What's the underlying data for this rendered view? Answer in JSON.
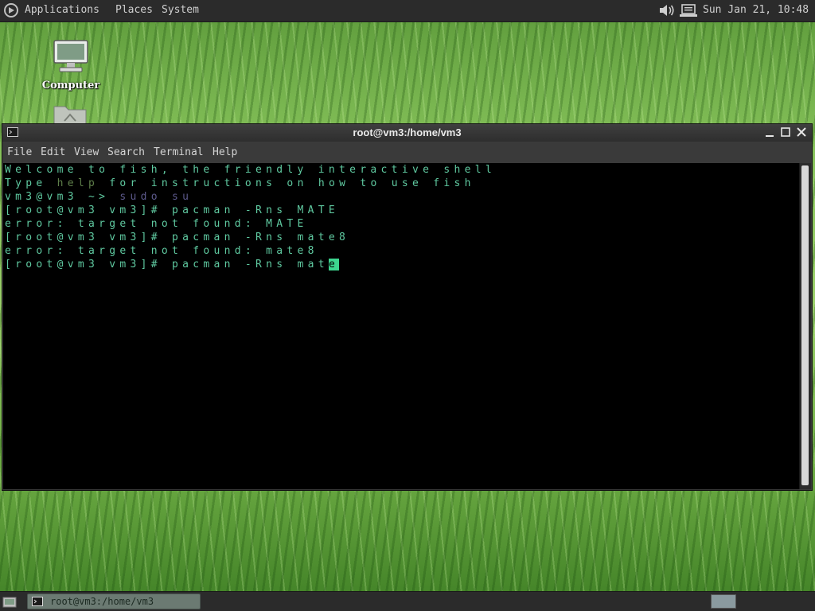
{
  "top_panel": {
    "menus": [
      "Applications",
      "Places",
      "System"
    ],
    "clock": "Sun Jan 21, 10:48",
    "icons": [
      "mate-menu-logo-icon",
      "speaker-volume-icon",
      "network-icon"
    ]
  },
  "desktop": {
    "icons": [
      {
        "label": "Computer",
        "icon": "computer-icon"
      },
      {
        "label": "",
        "icon": "folder-icon"
      }
    ]
  },
  "terminal": {
    "title": "root@vm3:/home/vm3",
    "menubar": [
      "File",
      "Edit",
      "View",
      "Search",
      "Terminal",
      "Help"
    ],
    "lines": [
      {
        "segments": [
          {
            "text": "Welcome to fish, the friendly interactive shell",
            "style": "normal"
          }
        ]
      },
      {
        "segments": [
          {
            "text": "Type ",
            "style": "normal"
          },
          {
            "text": "help",
            "style": "dim"
          },
          {
            "text": " for instructions on how to use fish",
            "style": "normal"
          }
        ]
      },
      {
        "segments": [
          {
            "text": "vm3@vm3 ~> ",
            "style": "normal"
          },
          {
            "text": "sudo su",
            "style": "purple"
          }
        ]
      },
      {
        "segments": [
          {
            "text": "[root@vm3 vm3]# pacman -Rns MATE",
            "style": "normal"
          }
        ]
      },
      {
        "segments": [
          {
            "text": "error: target not found: MATE",
            "style": "normal"
          }
        ]
      },
      {
        "segments": [
          {
            "text": "[root@vm3 vm3]# pacman -Rns mate8",
            "style": "normal"
          }
        ]
      },
      {
        "segments": [
          {
            "text": "error: target not found: mate8",
            "style": "normal"
          }
        ]
      },
      {
        "segments": [
          {
            "text": "[root@vm3 vm3]# pacman -Rns mat",
            "style": "normal"
          },
          {
            "text": "e",
            "style": "cursor"
          }
        ]
      }
    ],
    "colors": {
      "text": "#5fc9a0",
      "dim": "#5e7f4a",
      "command": "#5d5a8c",
      "cursor": "#3dd58f",
      "background": "#000000"
    }
  },
  "taskbar": {
    "tasks": [
      {
        "label": "root@vm3:/home/vm3",
        "icon": "terminal-icon"
      }
    ],
    "icons": [
      "show-desktop-icon",
      "workspace-switcher"
    ]
  }
}
